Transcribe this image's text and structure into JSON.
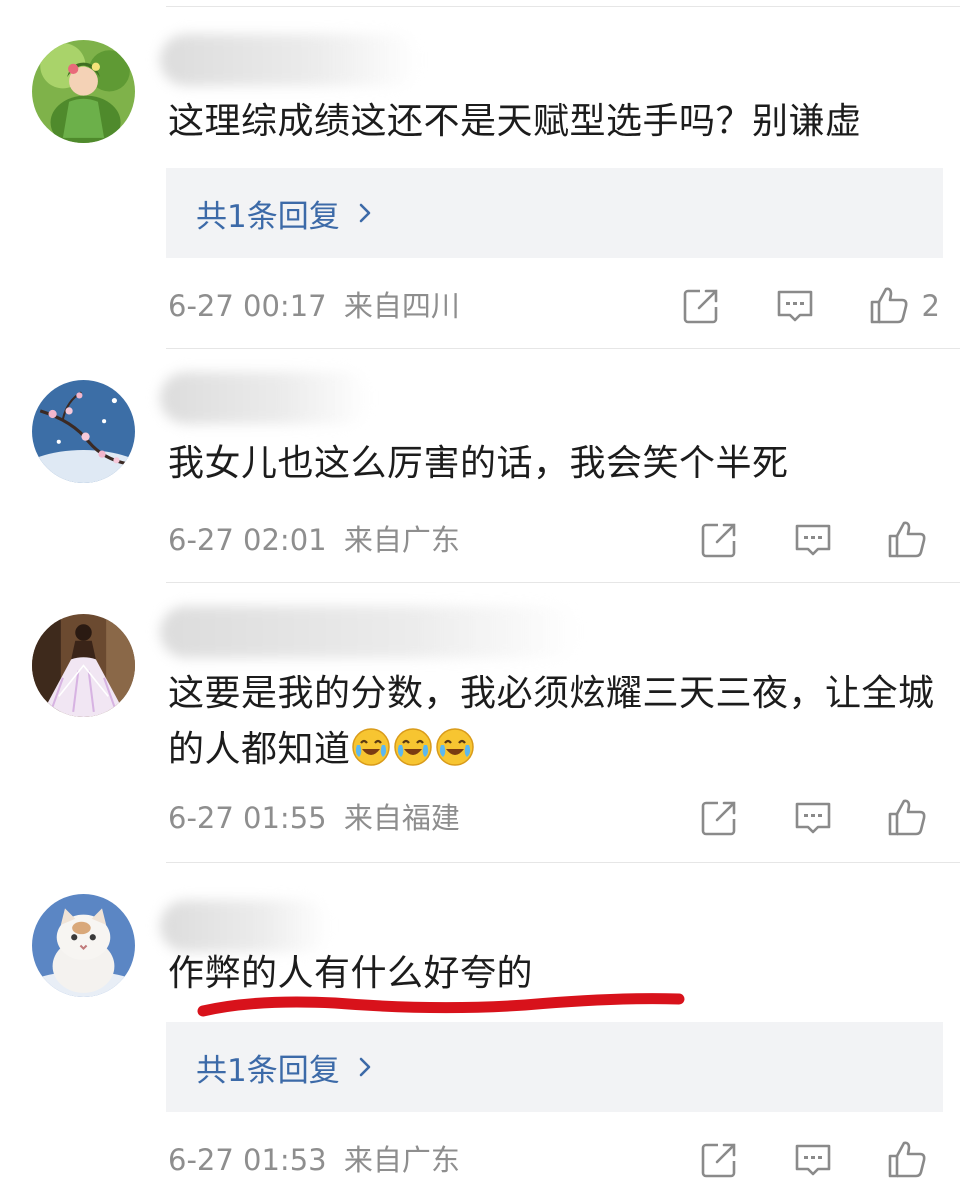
{
  "comments": [
    {
      "username": "",
      "avatar": "girl-in-green-avatar",
      "text": "这理综成绩这还不是天赋型选手吗？别谦虚",
      "reply_label": "共1条回复",
      "time": "6-27 00:17",
      "location": "来自四川",
      "likes": "2"
    },
    {
      "username": "",
      "avatar": "plum-blossom-avatar",
      "text": "我女儿也这么厉害的话，我会笑个半死",
      "reply_label": "",
      "time": "6-27 02:01",
      "location": "来自广东",
      "likes": ""
    },
    {
      "username": "",
      "avatar": "woman-in-gown-avatar",
      "text": "这要是我的分数，我必须炫耀三天三夜，让全城的人都知道",
      "emojis": [
        "crying-laughing-emoji",
        "crying-laughing-emoji",
        "crying-laughing-emoji"
      ],
      "reply_label": "",
      "time": "6-27 01:55",
      "location": "来自福建",
      "likes": ""
    },
    {
      "username": "",
      "avatar": "white-cat-avatar",
      "text": "作弊的人有什么好夸的",
      "reply_label": "共1条回复",
      "time": "6-27 01:53",
      "location": "来自广东",
      "likes": ""
    }
  ],
  "colors": {
    "reply_link": "#3c6aa8",
    "meta_text": "#8e8e8e",
    "reply_box_bg": "#f2f3f5",
    "annotation_red": "#d8121b"
  },
  "icons": {
    "share": "share-icon",
    "comment": "comment-icon",
    "like": "thumbs-up-icon",
    "reply_arrow": "chevron-right-icon"
  }
}
